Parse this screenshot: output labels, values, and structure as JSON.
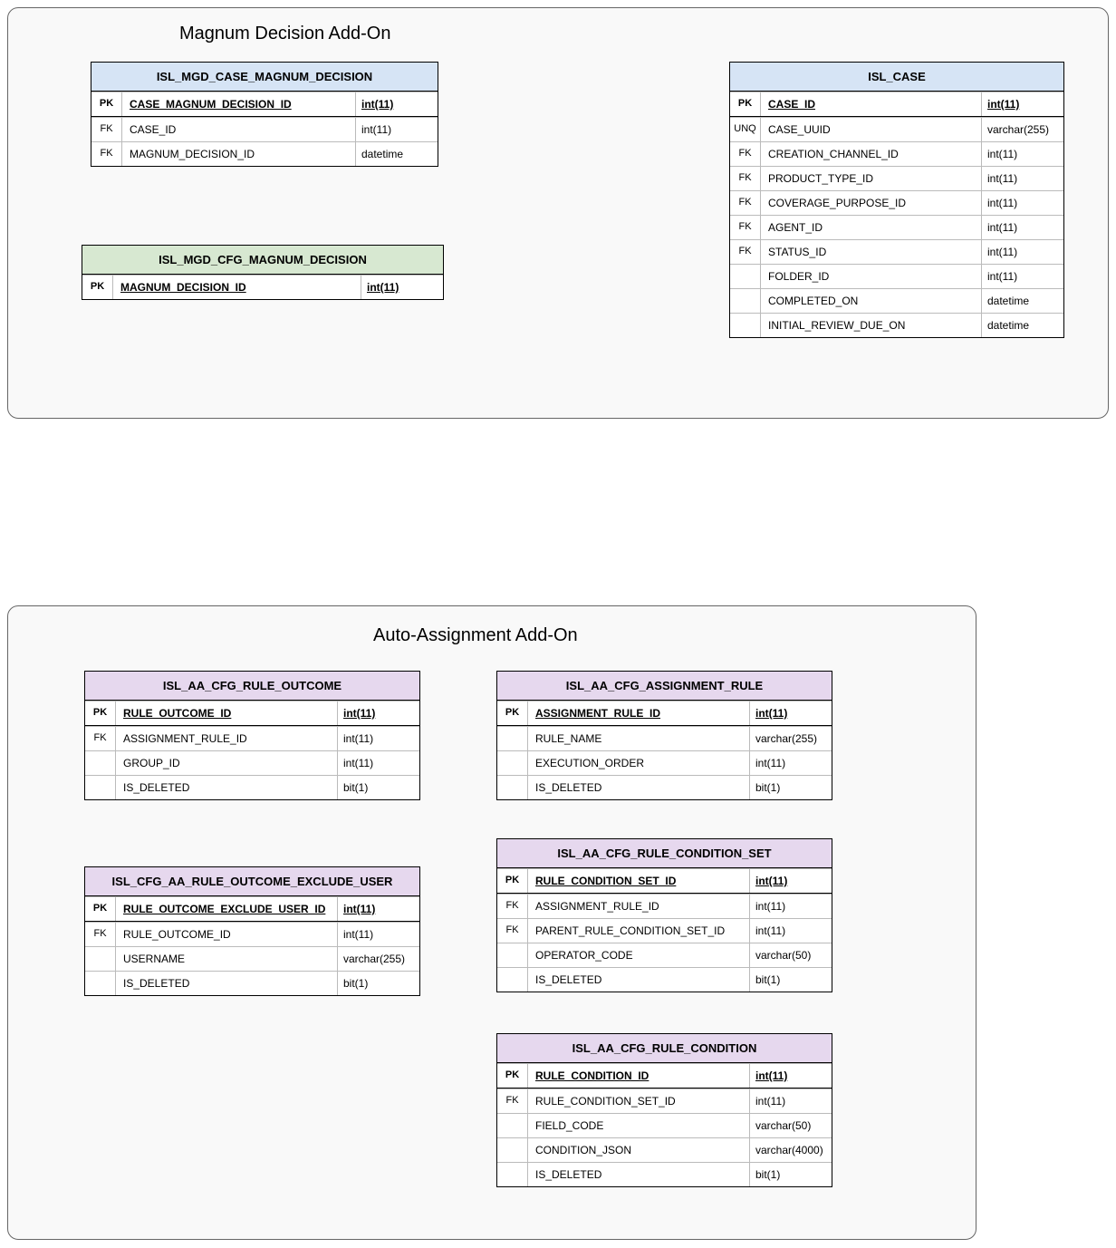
{
  "group1": {
    "title": "Magnum Decision Add-On"
  },
  "group2": {
    "title": "Auto-Assignment Add-On"
  },
  "entities": {
    "mcd": {
      "title": "ISL_MGD_CASE_MAGNUM_DECISION",
      "pk": {
        "name": "CASE_MAGNUM_DECISION_ID",
        "type": "int(11)"
      },
      "rows": [
        {
          "key": "FK",
          "name": "CASE_ID",
          "type": "int(11)"
        },
        {
          "key": "FK",
          "name": "MAGNUM_DECISION_ID",
          "type": "datetime"
        }
      ]
    },
    "case": {
      "title": "ISL_CASE",
      "pk": {
        "name": "CASE_ID",
        "type": "int(11)"
      },
      "rows": [
        {
          "key": "UNQ",
          "name": "CASE_UUID",
          "type": "varchar(255)"
        },
        {
          "key": "FK",
          "name": "CREATION_CHANNEL_ID",
          "type": "int(11)"
        },
        {
          "key": "FK",
          "name": "PRODUCT_TYPE_ID",
          "type": "int(11)"
        },
        {
          "key": "FK",
          "name": "COVERAGE_PURPOSE_ID",
          "type": "int(11)"
        },
        {
          "key": "FK",
          "name": "AGENT_ID",
          "type": "int(11)"
        },
        {
          "key": "FK",
          "name": "STATUS_ID",
          "type": "int(11)"
        },
        {
          "key": "",
          "name": "FOLDER_ID",
          "type": "int(11)"
        },
        {
          "key": "",
          "name": "COMPLETED_ON",
          "type": "datetime"
        },
        {
          "key": "",
          "name": "INITIAL_REVIEW_DUE_ON",
          "type": "datetime"
        }
      ]
    },
    "cfgmd": {
      "title": "ISL_MGD_CFG_MAGNUM_DECISION",
      "pk": {
        "name": "MAGNUM_DECISION_ID",
        "type": "int(11)"
      }
    },
    "outcome": {
      "title": "ISL_AA_CFG_RULE_OUTCOME",
      "pk": {
        "name": "RULE_OUTCOME_ID",
        "type": "int(11)"
      },
      "rows": [
        {
          "key": "FK",
          "name": "ASSIGNMENT_RULE_ID",
          "type": "int(11)"
        },
        {
          "key": "",
          "name": "GROUP_ID",
          "type": "int(11)"
        },
        {
          "key": "",
          "name": "IS_DELETED",
          "type": "bit(1)"
        }
      ]
    },
    "exclude": {
      "title": "ISL_CFG_AA_RULE_OUTCOME_EXCLUDE_USER",
      "pk": {
        "name": "RULE_OUTCOME_EXCLUDE_USER_ID",
        "type": "int(11)"
      },
      "rows": [
        {
          "key": "FK",
          "name": "RULE_OUTCOME_ID",
          "type": "int(11)"
        },
        {
          "key": "",
          "name": "USERNAME",
          "type": "varchar(255)"
        },
        {
          "key": "",
          "name": "IS_DELETED",
          "type": "bit(1)"
        }
      ]
    },
    "assignrule": {
      "title": "ISL_AA_CFG_ASSIGNMENT_RULE",
      "pk": {
        "name": "ASSIGNMENT_RULE_ID",
        "type": "int(11)"
      },
      "rows": [
        {
          "key": "",
          "name": "RULE_NAME",
          "type": "varchar(255)"
        },
        {
          "key": "",
          "name": "EXECUTION_ORDER",
          "type": "int(11)"
        },
        {
          "key": "",
          "name": "IS_DELETED",
          "type": "bit(1)"
        }
      ]
    },
    "condset": {
      "title": "ISL_AA_CFG_RULE_CONDITION_SET",
      "pk": {
        "name": "RULE_CONDITION_SET_ID",
        "type": "int(11)"
      },
      "rows": [
        {
          "key": "FK",
          "name": "ASSIGNMENT_RULE_ID",
          "type": "int(11)"
        },
        {
          "key": "FK",
          "name": "PARENT_RULE_CONDITION_SET_ID",
          "type": "int(11)"
        },
        {
          "key": "",
          "name": "OPERATOR_CODE",
          "type": "varchar(50)"
        },
        {
          "key": "",
          "name": "IS_DELETED",
          "type": "bit(1)"
        }
      ]
    },
    "cond": {
      "title": "ISL_AA_CFG_RULE_CONDITION",
      "pk": {
        "name": "RULE_CONDITION_ID",
        "type": "int(11)"
      },
      "rows": [
        {
          "key": "FK",
          "name": "RULE_CONDITION_SET_ID",
          "type": "int(11)"
        },
        {
          "key": "",
          "name": "FIELD_CODE",
          "type": "varchar(50)"
        },
        {
          "key": "",
          "name": "CONDITION_JSON",
          "type": "varchar(4000)"
        },
        {
          "key": "",
          "name": "IS_DELETED",
          "type": "bit(1)"
        }
      ]
    }
  }
}
